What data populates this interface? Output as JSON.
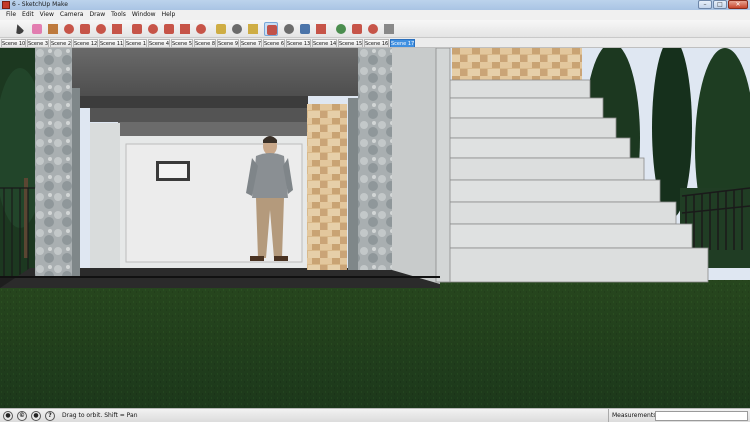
{
  "window": {
    "title": "6 - SketchUp Make",
    "minimize": "–",
    "maximize": "□",
    "close": "✕"
  },
  "menu": [
    "File",
    "Edit",
    "View",
    "Camera",
    "Draw",
    "Tools",
    "Window",
    "Help"
  ],
  "toolbar": {
    "tools": [
      {
        "name": "select-tool",
        "icon": "arrow-icon",
        "color": "#222222"
      },
      {
        "name": "eraser-tool",
        "icon": "eraser-icon",
        "color": "#e06aa6"
      },
      {
        "name": "pencil-tool",
        "icon": "pencil-icon",
        "color": "#b5651d"
      },
      {
        "name": "rectangle-tool",
        "icon": "rectangle-icon",
        "color": "#c0392b"
      },
      {
        "name": "circle-tool",
        "icon": "circle-icon",
        "color": "#c0392b"
      },
      {
        "name": "polygon-tool",
        "icon": "polygon-icon",
        "color": "#c0392b"
      },
      {
        "name": "arc-tool",
        "icon": "arc-icon",
        "color": "#c0392b"
      },
      {
        "name": "push-pull-tool",
        "icon": "push-pull-icon",
        "color": "#c0392b"
      },
      {
        "name": "follow-me-tool",
        "icon": "follow-me-icon",
        "color": "#c0392b"
      },
      {
        "name": "move-tool",
        "icon": "move-icon",
        "color": "#c0392b"
      },
      {
        "name": "rotate-tool",
        "icon": "rotate-icon",
        "color": "#c0392b"
      },
      {
        "name": "scale-tool",
        "icon": "scale-icon",
        "color": "#c0392b"
      },
      {
        "name": "tape-measure-tool",
        "icon": "tape-measure-icon",
        "color": "#c9a227"
      },
      {
        "name": "text-tool",
        "icon": "text-icon",
        "color": "#555555"
      },
      {
        "name": "paint-bucket-tool",
        "icon": "paint-bucket-icon",
        "color": "#c9a227"
      },
      {
        "name": "orbit-tool",
        "icon": "orbit-icon",
        "color": "#c0392b"
      },
      {
        "name": "walk-tool",
        "icon": "walk-icon",
        "color": "#555555"
      },
      {
        "name": "zoom-tool",
        "icon": "zoom-icon",
        "color": "#2f5f9e"
      },
      {
        "name": "zoom-extents-tool",
        "icon": "zoom-extents-icon",
        "color": "#c0392b"
      },
      {
        "name": "warehouse-tool",
        "icon": "warehouse-icon",
        "color": "#2e7d32"
      },
      {
        "name": "components-tool",
        "icon": "components-icon",
        "color": "#c0392b"
      },
      {
        "name": "extensions-tool",
        "icon": "extensions-icon",
        "color": "#c0392b"
      },
      {
        "name": "get-models-tool",
        "icon": "get-models-icon",
        "color": "#777777"
      }
    ]
  },
  "scenes": {
    "tabs": [
      "Scene 10",
      "Scene 3",
      "Scene 2",
      "Scene 12",
      "Scene 11",
      "Scene 1",
      "Scene 4",
      "Scene 5",
      "Scene 8",
      "Scene 9",
      "Scene 7",
      "Scene 6",
      "Scene 13",
      "Scene 14",
      "Scene 15",
      "Scene 16",
      "Scene 17"
    ],
    "active": "Scene 17"
  },
  "colors": {
    "grass": "#1f3d17",
    "floor": "#2b2b2b",
    "pillar_stone": "#a8aeb0",
    "stone_veneer": "#d8b88a",
    "wall_white": "#e8eaea",
    "ceiling": "#5a5a5a",
    "tree": "#1c3820",
    "sky": "#dfe7f2",
    "accent_active": "#3f8fe0"
  },
  "status": {
    "hint": "Drag to orbit.  Shift = Pan",
    "measurements_label": "Measurements",
    "measurements_value": ""
  }
}
